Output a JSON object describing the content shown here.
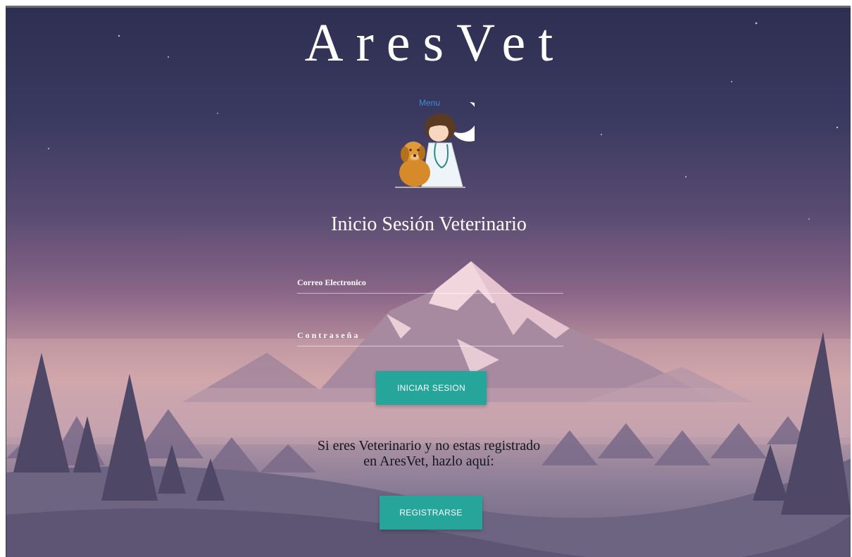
{
  "brand": {
    "title": "AresVet"
  },
  "logo": {
    "menu_label": "Menu",
    "icon": "vet-with-dog-and-moon"
  },
  "login": {
    "heading": "Inicio Sesión Veterinario",
    "email_placeholder": "Correo Electronico",
    "password_placeholder": "Contraseña",
    "submit_label": "INICIAR SESION"
  },
  "register": {
    "message_line1": "Si eres Veterinario y no estas registrado",
    "message_line2": "en AresVet, hazlo aquí:",
    "button_label": "REGISTRARSE"
  },
  "colors": {
    "button": "#26a69a",
    "text_light": "#ffffff",
    "text_dark": "#151520",
    "menu_link": "#3d8bd8"
  }
}
